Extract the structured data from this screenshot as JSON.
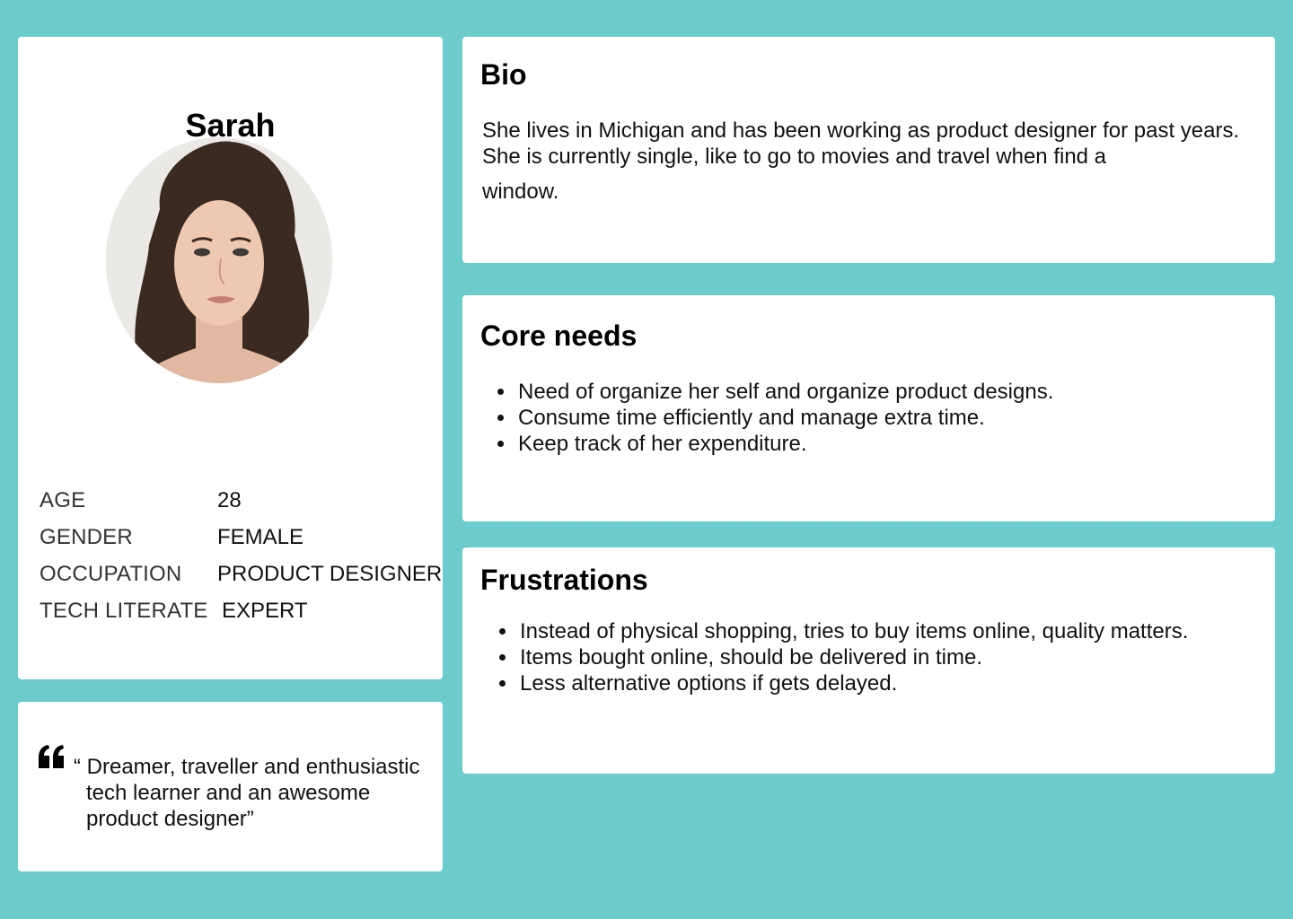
{
  "profile": {
    "name": "Sarah",
    "facts": [
      {
        "label": "AGE",
        "value": "28"
      },
      {
        "label": "GENDER",
        "value": "FEMALE"
      },
      {
        "label": "OCCUPATION",
        "value": "PRODUCT DESIGNER"
      },
      {
        "label": "TECH LITERATE",
        "value": "EXPERT"
      }
    ]
  },
  "quote": {
    "icon": "quote-icon",
    "text": "“ Dreamer, traveller and enthusiastic tech learner and an awesome product designer”"
  },
  "bio": {
    "title": "Bio",
    "text_main": "She lives in Michigan and has been working as product designer for past years. She is currently single, like to go to movies and travel when find a",
    "text_end": "window."
  },
  "core_needs": {
    "title": "Core needs",
    "items": [
      "Need of organize her self and organize product  designs.",
      "Consume time efficiently and manage extra time.",
      "Keep track of her expenditure."
    ]
  },
  "frustrations": {
    "title": "Frustrations",
    "items": [
      "Instead of physical shopping, tries to buy items online, quality matters.",
      "Items bought online, should be delivered in time.",
      "Less alternative options if gets delayed."
    ]
  },
  "colors": {
    "background": "#6ccbcb",
    "card": "#ffffff"
  }
}
